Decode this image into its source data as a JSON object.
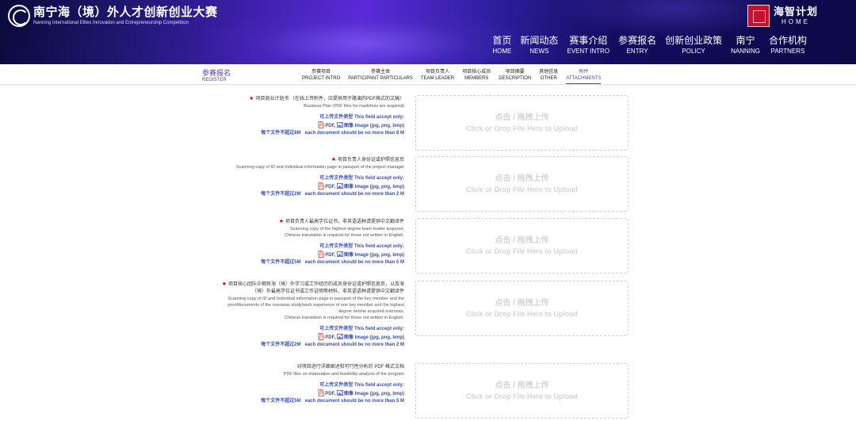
{
  "header": {
    "logo": {
      "title_cn": "南宁海（境）外人才创新创业大赛",
      "title_en": "Nanning International Elites Innovation and Entrepreneurship Competition"
    },
    "haizhi": {
      "title_cn": "海智计划",
      "title_en": "HOME"
    },
    "nav": [
      {
        "cn": "首页",
        "en": "HOME"
      },
      {
        "cn": "新闻动态",
        "en": "NEWS"
      },
      {
        "cn": "赛事介绍",
        "en": "EVENT INTRO"
      },
      {
        "cn": "参赛报名",
        "en": "ENTRY"
      },
      {
        "cn": "创新创业政策",
        "en": "POLICY"
      },
      {
        "cn": "南宁",
        "en": "NANNING"
      },
      {
        "cn": "合作机构",
        "en": "PARTNERS"
      }
    ]
  },
  "subnav": {
    "register": {
      "cn": "参赛报名",
      "en": "REGISTER"
    },
    "steps": [
      {
        "cn": "参赛项目",
        "en": "PROJECT INTRO"
      },
      {
        "cn": "参赛主体",
        "en": "PARTICIPANT PARTICULARS"
      },
      {
        "cn": "项目负责人",
        "en": "TEAM LEADER"
      },
      {
        "cn": "项目核心成员",
        "en": "MEMBERS"
      },
      {
        "cn": "项目摘要",
        "en": "DESCRIPTION"
      },
      {
        "cn": "其他信息",
        "en": "OTHER"
      },
      {
        "cn": "附件",
        "en": "ATTACHMENTS"
      }
    ],
    "active_step": "ATTACHMENTS"
  },
  "accept": {
    "type_cn": "可上传文件类型",
    "type_en": "This field accept only:",
    "pdf": "PDF,",
    "image_cn": "图像",
    "image_en": "Image (jpg, png, bmp)",
    "limit_cn_prefix": "每个文件不超过",
    "limit_en_prefix": "each document should be no more than"
  },
  "dropzone": {
    "cn": "点击 / 拖拽上传",
    "en": "Click or Drop File Here to Upload"
  },
  "fields": [
    {
      "required": true,
      "cn": [
        "项目商业计划书 （在线上传附件，应提供用于路演的PDF格式的文稿）"
      ],
      "en": [
        "Business Plan (PDF files for roadshow are required)"
      ],
      "limit": "8M",
      "limit_en": "8 M"
    },
    {
      "required": true,
      "cn": [
        "项目负责人身份证或护照信息页"
      ],
      "en": [
        "Scanning copy of ID and Individual information page in passport of the project manager"
      ],
      "limit": "2M",
      "limit_en": "2 M"
    },
    {
      "required": true,
      "cn": [
        "项目负责人最高学位证书，非英语语种请提供中文翻译件"
      ],
      "en": [
        "Scanning copy of the highest degree team leader acquired.",
        "Chinese translation is required for those not written in English."
      ],
      "limit": "5M",
      "limit_en": "5 M"
    },
    {
      "required": true,
      "cn": [
        "项目核心团队中拥有海（境）外学习或工作经历的成员身份证或护照信息页，以及海",
        "（境）外最高学位证书或工作证明等材料，非英语语种请提供中文翻译件"
      ],
      "en": [
        "Scanning copy of ID and Individual information page in passport of the key member and the",
        "proofdocuments of the overseas study/work experience of one key member and the highest",
        "degree he/she acquired overseas.",
        "Chinese translation is required for those not written in English."
      ],
      "limit": "2M",
      "limit_en": "2 M"
    },
    {
      "required": false,
      "cn": [
        "对项目进行详细阐述和可行性分析的 PDF 格式文档"
      ],
      "en": [
        "PDF files on elaboration and feasibility analysis of the program"
      ],
      "limit": "5M",
      "limit_en": "5 M"
    }
  ],
  "colors": {
    "accent": "#5a3e9c",
    "link_blue": "#3a4fb0",
    "required_red": "#d0021b",
    "header_purple": "#3b1fa8"
  }
}
